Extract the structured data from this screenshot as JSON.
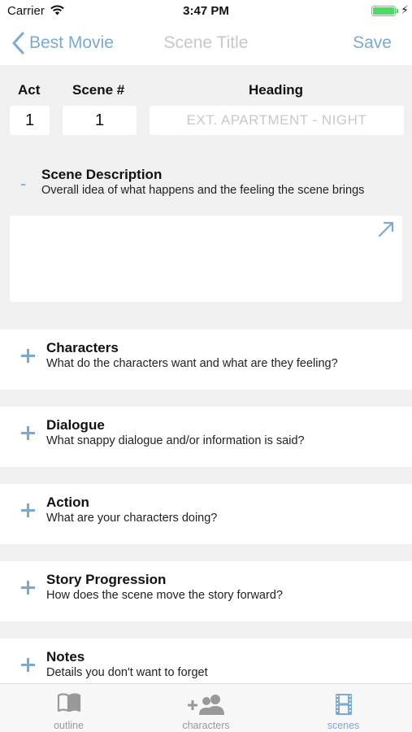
{
  "status_bar": {
    "carrier": "Carrier",
    "time": "3:47 PM",
    "battery_level": 1.0
  },
  "nav": {
    "back_label": "Best Movie",
    "title": "Scene Title",
    "save_label": "Save"
  },
  "scene": {
    "act_label": "Act",
    "act_value": "1",
    "scene_label": "Scene #",
    "scene_value": "1",
    "heading_label": "Heading",
    "heading_placeholder": "EXT. APARTMENT - NIGHT"
  },
  "description": {
    "toggle": "-",
    "title": "Scene Description",
    "subtitle": "Overall idea of what happens and the feeling the scene brings",
    "value": ""
  },
  "sections": [
    {
      "title": "Characters",
      "subtitle": "What do the characters want and what are they feeling?"
    },
    {
      "title": "Dialogue",
      "subtitle": "What snappy dialogue and/or information is said?"
    },
    {
      "title": "Action",
      "subtitle": "What are your characters doing?"
    },
    {
      "title": "Story Progression",
      "subtitle": "How does the scene move the story forward?"
    },
    {
      "title": "Notes",
      "subtitle": "Details you don't want to forget"
    }
  ],
  "tabs": [
    {
      "label": "outline",
      "icon": "book-icon",
      "active": false
    },
    {
      "label": "characters",
      "icon": "add-people-icon",
      "active": false
    },
    {
      "label": "scenes",
      "icon": "film-strip-icon",
      "active": true
    }
  ],
  "colors": {
    "accent": "#7aa9d3",
    "inactive": "#999999",
    "background": "#f0f0f0",
    "battery": "#4cd964"
  }
}
